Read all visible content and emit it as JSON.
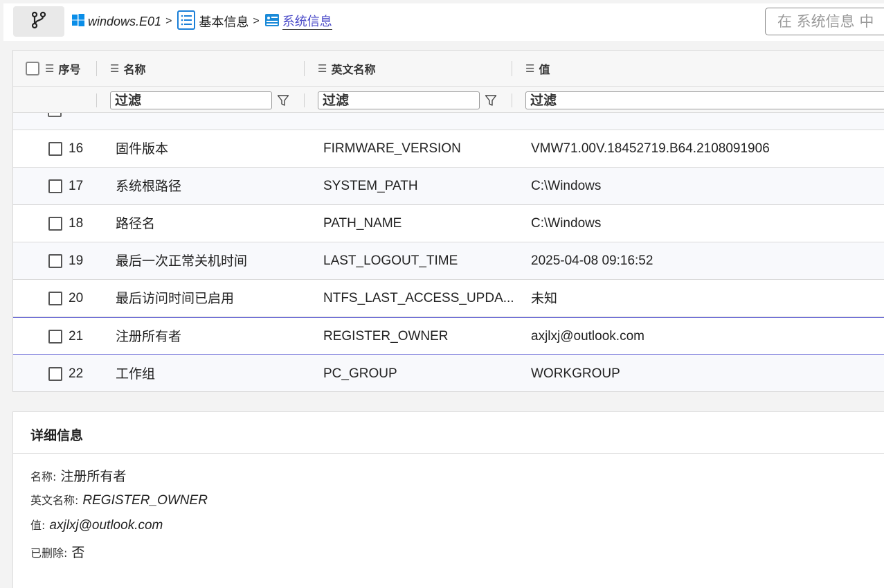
{
  "breadcrumb": {
    "items": [
      {
        "label": "windows.E01",
        "icon": "windows-logo-icon"
      },
      {
        "label": "基本信息",
        "icon": "list-icon"
      },
      {
        "label": "系统信息",
        "icon": "system-info-icon"
      }
    ],
    "separator": ">"
  },
  "search": {
    "placeholder": "在 系统信息 中"
  },
  "table": {
    "columns": [
      {
        "label": "序号"
      },
      {
        "label": "名称"
      },
      {
        "label": "英文名称"
      },
      {
        "label": "值"
      }
    ],
    "filter_placeholder": "过滤",
    "rows": [
      {
        "index": "16",
        "name": "固件版本",
        "en_name": "FIRMWARE_VERSION",
        "value": "VMW71.00V.18452719.B64.2108091906"
      },
      {
        "index": "17",
        "name": "系统根路径",
        "en_name": "SYSTEM_PATH",
        "value": "C:\\Windows"
      },
      {
        "index": "18",
        "name": "路径名",
        "en_name": "PATH_NAME",
        "value": "C:\\Windows"
      },
      {
        "index": "19",
        "name": "最后一次正常关机时间",
        "en_name": "LAST_LOGOUT_TIME",
        "value": "2025-04-08 09:16:52"
      },
      {
        "index": "20",
        "name": "最后访问时间已启用",
        "en_name": "NTFS_LAST_ACCESS_UPDA...",
        "value": "未知"
      },
      {
        "index": "21",
        "name": "注册所有者",
        "en_name": "REGISTER_OWNER",
        "value": "axjlxj@outlook.com"
      },
      {
        "index": "22",
        "name": "工作组",
        "en_name": "PC_GROUP",
        "value": "WORKGROUP"
      }
    ],
    "selected_index": "21"
  },
  "details": {
    "title": "详细信息",
    "fields": [
      {
        "label": "名称:",
        "value": "注册所有者"
      },
      {
        "label": "英文名称:",
        "value": "REGISTER_OWNER"
      },
      {
        "label": "值:",
        "value": "axjlxj@outlook.com"
      },
      {
        "label": "已删除:",
        "value": "否"
      }
    ]
  },
  "colors": {
    "accent": "#4a4ac8",
    "selection_border": "#6b6bd6",
    "windows_blue": "#0078d4",
    "row_alt": "#f8f9fc"
  }
}
